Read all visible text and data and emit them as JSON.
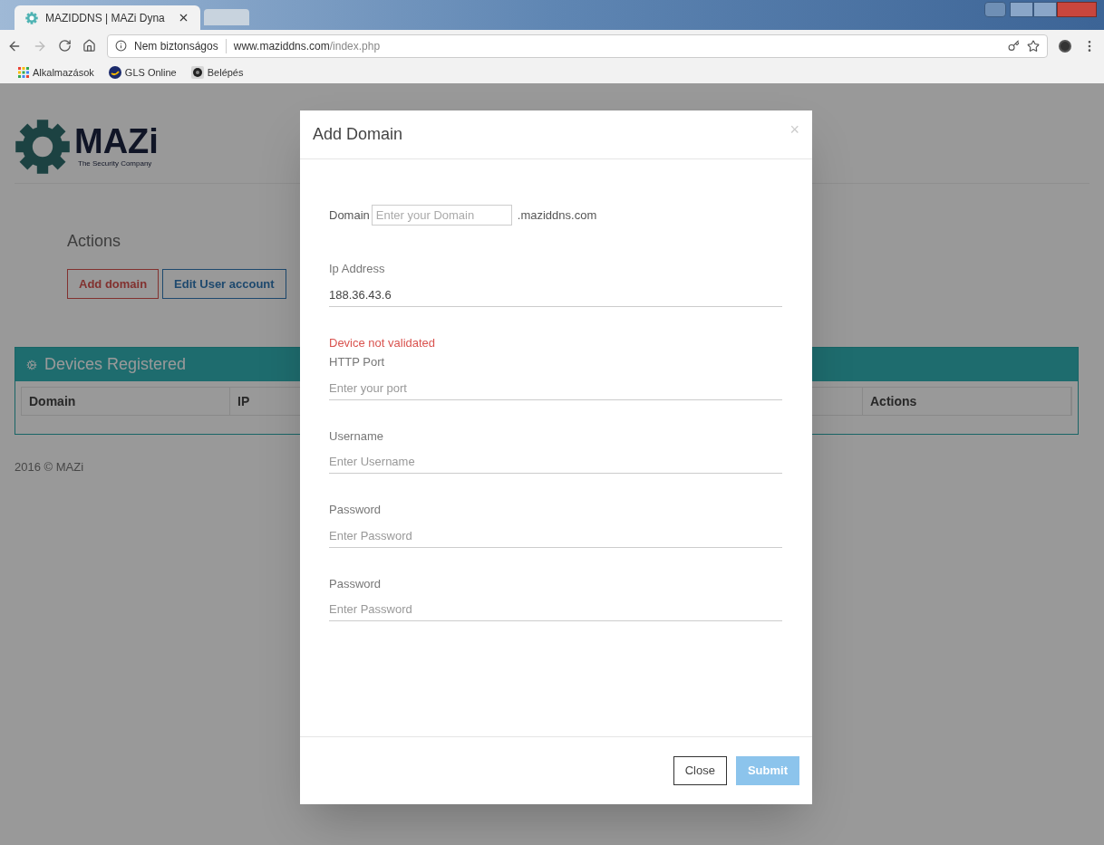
{
  "browser": {
    "tabs": [
      {
        "title": "MAZIDDNS | MAZi Dyna",
        "selected": true
      },
      {
        "selected": false
      }
    ],
    "address": {
      "security": "Nem biztonságos",
      "host": "www.maziddns.com",
      "path": "/index.php"
    },
    "bookmarks": [
      {
        "label": "Alkalmazások",
        "kind": "apps"
      },
      {
        "label": "GLS Online",
        "kind": "gls"
      },
      {
        "label": "Belépés",
        "kind": "login"
      }
    ]
  },
  "page": {
    "logo": {
      "name": "MAZi",
      "tagline": "The Security Company"
    },
    "actions_title": "Actions",
    "action_buttons": [
      {
        "label": "Add domain",
        "kind": "danger"
      },
      {
        "label": "Edit User account",
        "kind": "info"
      }
    ],
    "devices_panel": {
      "title": "Devices Registered",
      "columns": [
        "Domain",
        "IP",
        "Actions"
      ]
    },
    "footer": "2016 © MAZi"
  },
  "modal": {
    "title": "Add Domain",
    "close": "×",
    "fields": [
      {
        "kind": "domain",
        "label": "Domain",
        "placeholder": "Enter your Domain",
        "suffix": ".maziddns.com"
      },
      {
        "kind": "line",
        "label": "Ip Address",
        "value": "188.36.43.6"
      },
      {
        "kind": "line",
        "error": "Device not validated",
        "label": "HTTP Port",
        "placeholder": "Enter your port"
      },
      {
        "kind": "line",
        "label": "Username",
        "placeholder": "Enter Username"
      },
      {
        "kind": "line",
        "label": "Password",
        "placeholder": "Enter Password"
      },
      {
        "kind": "line",
        "label": "Password",
        "placeholder": "Enter Password"
      }
    ],
    "buttons": [
      {
        "label": "Close",
        "kind": "default",
        "disabled": false
      },
      {
        "label": "Submit",
        "kind": "primary",
        "disabled": true
      }
    ]
  }
}
